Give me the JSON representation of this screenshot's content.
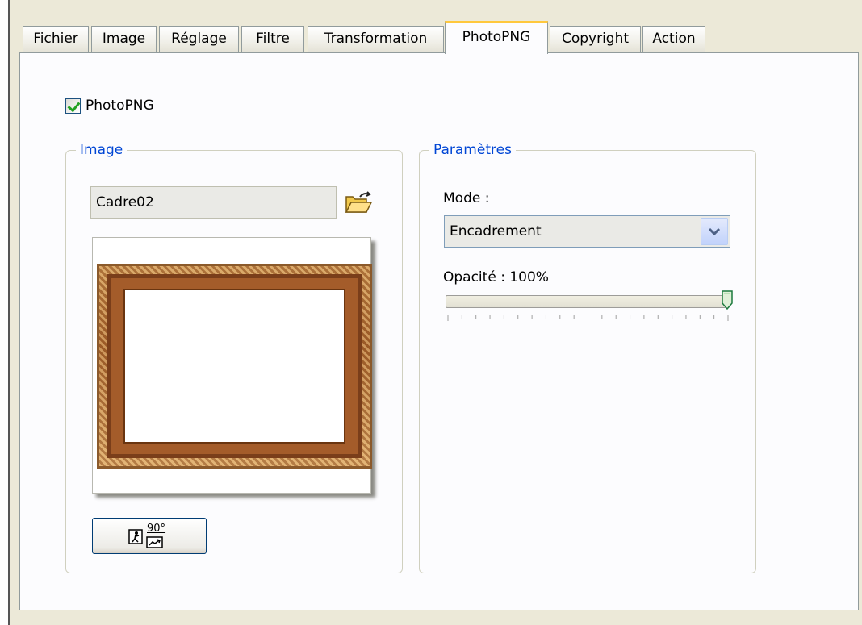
{
  "tabs": [
    {
      "label": "Fichier",
      "active": false
    },
    {
      "label": "Image",
      "active": false
    },
    {
      "label": "Réglage",
      "active": false
    },
    {
      "label": "Filtre",
      "active": false
    },
    {
      "label": "Transformation",
      "active": false
    },
    {
      "label": "PhotoPNG",
      "active": true
    },
    {
      "label": "Copyright",
      "active": false
    },
    {
      "label": "Action",
      "active": false
    }
  ],
  "enable": {
    "label": "PhotoPNG",
    "checked": true
  },
  "image_group": {
    "title": "Image",
    "file_name": "Cadre02",
    "open_icon": "open-folder-icon",
    "rotate_icon": "rotate-90-icon",
    "rotate_text": "90°"
  },
  "params_group": {
    "title": "Paramètres",
    "mode_label": "Mode :",
    "mode_value": "Encadrement",
    "opacity_label": "Opacité : 100%",
    "opacity_value": 100
  },
  "colors": {
    "accent_tab": "#ffc83c",
    "group_title": "#0046d5",
    "check": "#21a121"
  }
}
